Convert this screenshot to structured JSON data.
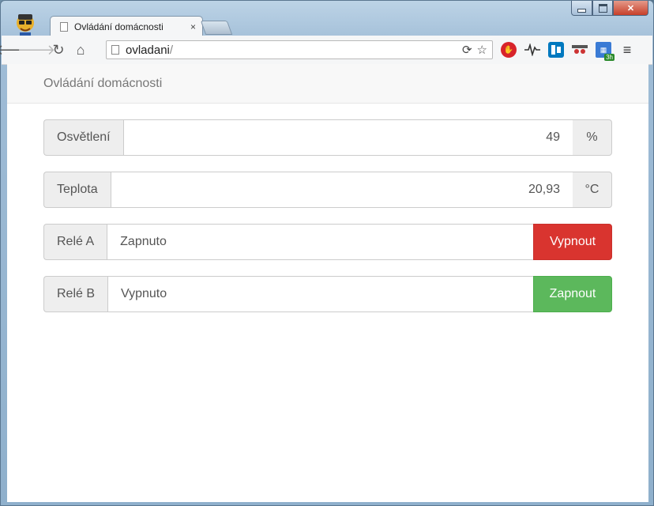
{
  "browser": {
    "tab_title": "Ovládání domácnosti",
    "tab_close": "×",
    "url_host": "ovladani",
    "url_path": "/"
  },
  "page": {
    "brand": "Ovládání domácnosti",
    "rows": [
      {
        "label": "Osvětlení",
        "value": "49",
        "unit": "%"
      },
      {
        "label": "Teplota",
        "value": "20,93",
        "unit": "°C"
      },
      {
        "label": "Relé A",
        "value": "Zapnuto",
        "button": "Vypnout"
      },
      {
        "label": "Relé B",
        "value": "Vypnuto",
        "button": "Zapnout"
      }
    ]
  },
  "colors": {
    "danger": "#d9342f",
    "success": "#5cb85c"
  }
}
